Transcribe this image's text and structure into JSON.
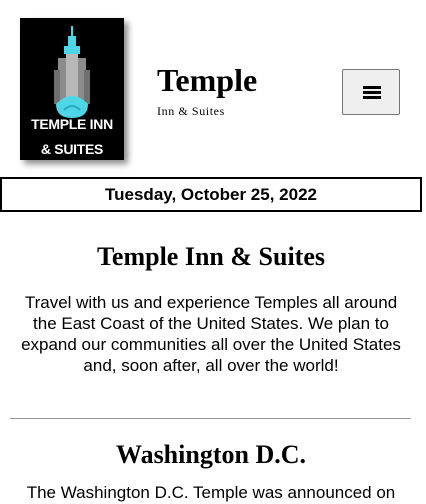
{
  "header": {
    "logo": {
      "line1": "TEMPLE INN",
      "line2": "& SUITES"
    },
    "title": "Temple",
    "subtitle": "Inn & Suites",
    "menu_icon": "hamburger-icon"
  },
  "date_bar": {
    "text": "Tuesday, October 25, 2022"
  },
  "intro": {
    "title": "Temple Inn & Suites",
    "text": "Travel with us and experience Temples all around the East Coast of the United States. We plan to expand our communities all over the United States and, soon after, all over the world!"
  },
  "washington": {
    "title": "Washington D.C.",
    "text": "The Washington D.C. Temple was announced on"
  },
  "colors": {
    "logo_bg": "#000000",
    "logo_accent": "#4fd6e6",
    "logo_gray": "#9a9a9a",
    "divider": "#999999"
  }
}
